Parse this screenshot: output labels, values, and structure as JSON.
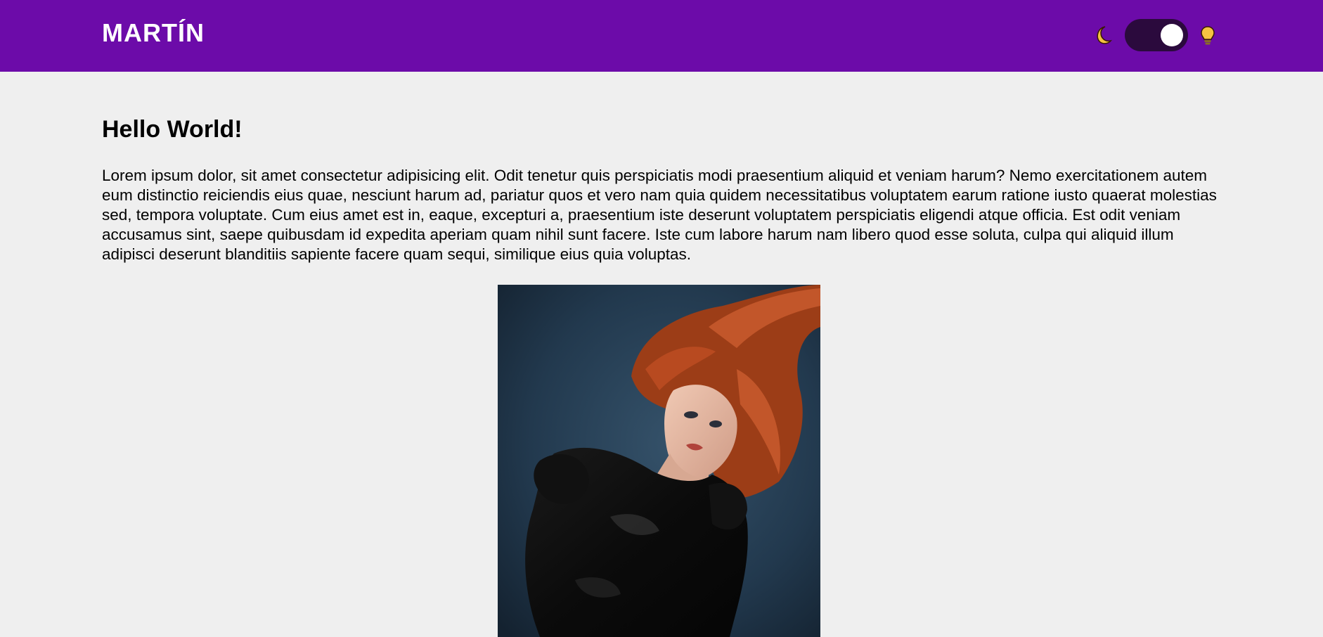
{
  "header": {
    "brand": "MARTÍN",
    "background_color": "#6c0ba9",
    "theme_toggle": {
      "left_icon": "moon-icon",
      "right_icon": "lightbulb-icon",
      "state": "on"
    }
  },
  "main": {
    "title": "Hello World!",
    "paragraph": "Lorem ipsum dolor, sit amet consectetur adipisicing elit. Odit tenetur quis perspiciatis modi praesentium aliquid et veniam harum? Nemo exercitationem autem eum distinctio reiciendis eius quae, nesciunt harum ad, pariatur quos et vero nam quia quidem necessitatibus voluptatem earum ratione iusto quaerat molestias sed, tempora voluptate. Cum eius amet est in, eaque, excepturi a, praesentium iste deserunt voluptatem perspiciatis eligendi atque officia. Est odit veniam accusamus sint, saepe quibusdam id expedita aperiam quam nihil sunt facere. Iste cum labore harum nam libero quod esse soluta, culpa qui aliquid illum adipisci deserunt blanditiis sapiente facere quam sequi, similique eius quia voluptas.",
    "image": "photo of a red-haired woman in a black leather top against a dark blue background"
  }
}
